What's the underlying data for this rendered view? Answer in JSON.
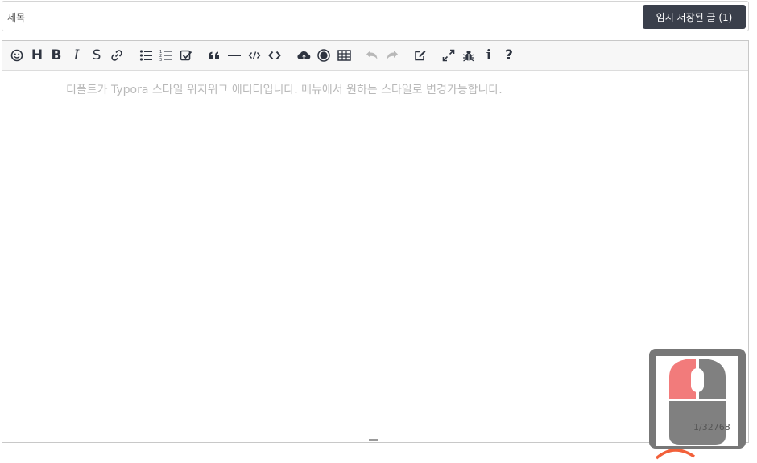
{
  "title_bar": {
    "placeholder": "제목",
    "value": "",
    "saved_button_label": "임시 저장된 글 (1)"
  },
  "toolbar": {
    "items": [
      {
        "name": "emoji",
        "icon": "smile-icon"
      },
      {
        "name": "heading",
        "icon": "heading-icon",
        "text": "H"
      },
      {
        "name": "bold",
        "icon": "bold-icon",
        "text": "B"
      },
      {
        "name": "italic",
        "icon": "italic-icon",
        "text": "I"
      },
      {
        "name": "strike",
        "icon": "strikethrough-icon",
        "text": "S"
      },
      {
        "name": "link",
        "icon": "link-icon"
      },
      {
        "name": "unordered-list",
        "icon": "list-ul-icon"
      },
      {
        "name": "ordered-list",
        "icon": "list-ol-icon"
      },
      {
        "name": "checklist",
        "icon": "check-square-icon"
      },
      {
        "name": "quote",
        "icon": "quote-icon"
      },
      {
        "name": "horizontal-rule",
        "icon": "hr-icon"
      },
      {
        "name": "inline-code",
        "icon": "code-icon"
      },
      {
        "name": "code-block",
        "icon": "code-block-icon"
      },
      {
        "name": "upload",
        "icon": "cloud-upload-icon"
      },
      {
        "name": "record",
        "icon": "record-icon"
      },
      {
        "name": "table",
        "icon": "table-icon"
      },
      {
        "name": "undo",
        "icon": "undo-icon",
        "disabled": true
      },
      {
        "name": "redo",
        "icon": "redo-icon",
        "disabled": true
      },
      {
        "name": "edit-mode",
        "icon": "edit-icon"
      },
      {
        "name": "fullscreen",
        "icon": "expand-icon"
      },
      {
        "name": "debug",
        "icon": "bug-icon"
      },
      {
        "name": "info",
        "icon": "info-icon",
        "text": "i"
      },
      {
        "name": "help",
        "icon": "help-icon",
        "text": "?"
      }
    ]
  },
  "editor": {
    "placeholder": "디폴트가 Typora 스타일 위지위그 에디터입니다. 메뉴에서 원하는 스타일로 변경가능합니다."
  },
  "overlay": {
    "mouse_icon": "mouse-icon",
    "counter": "1/32768",
    "colors": {
      "left_button": "#f27b7b",
      "body": "#808080",
      "scroll_arc": "#f2603a"
    }
  },
  "colors": {
    "button_bg": "#3a3f4b",
    "icon": "#2e3440",
    "icon_disabled": "#b8b8b8"
  }
}
